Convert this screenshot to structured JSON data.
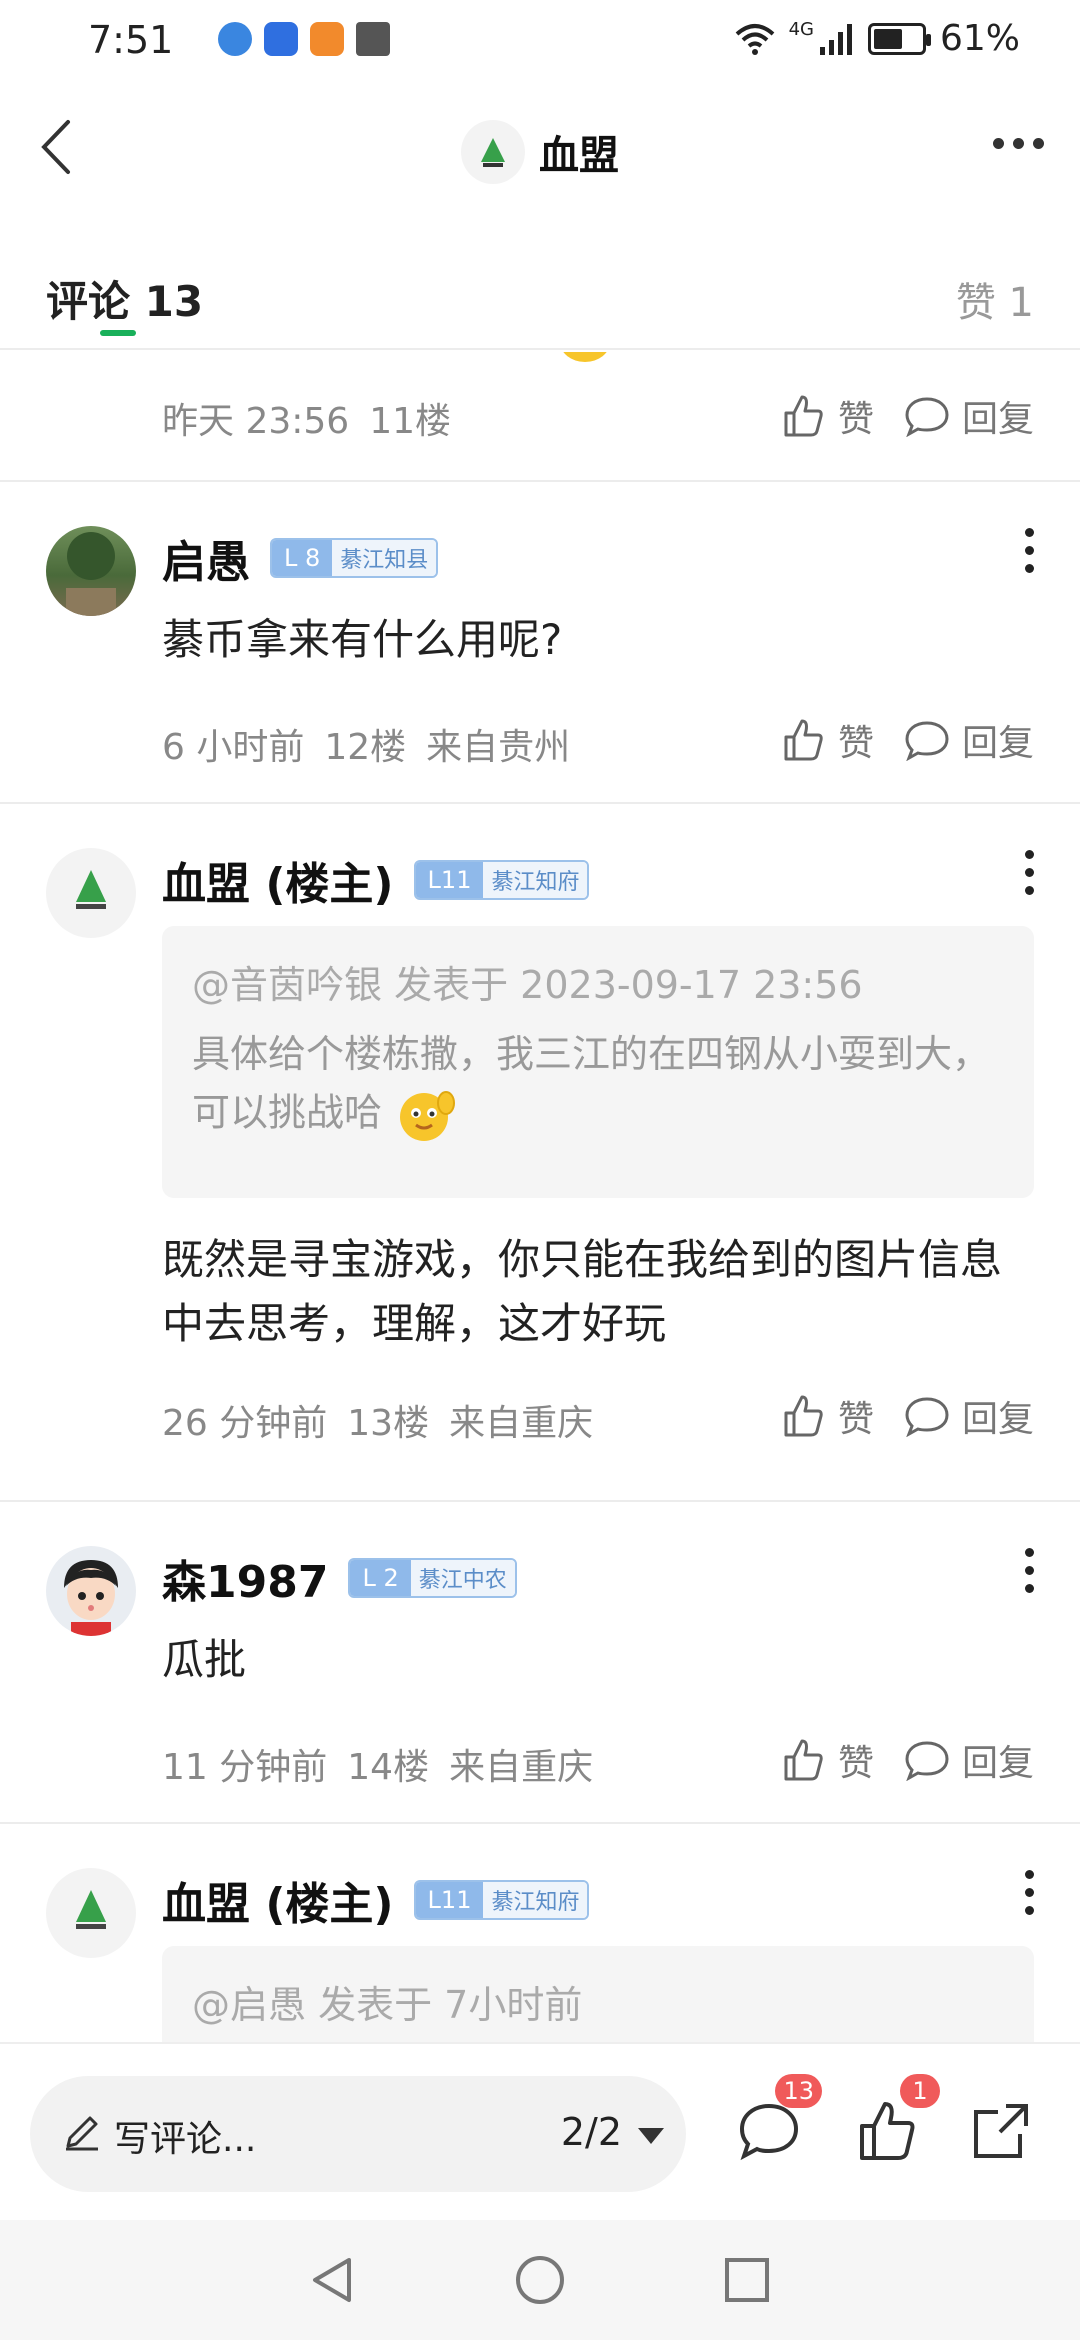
{
  "status_bar": {
    "time": "7:51",
    "battery": "61%",
    "network": "4G",
    "battery_level": 0.61
  },
  "header": {
    "title": "血盟"
  },
  "tabs": {
    "comments_label": "评论",
    "comments_count": "13",
    "likes_label": "赞 1"
  },
  "comments": [
    {
      "meta": {
        "time": "昨天 23:56",
        "floor": "11楼"
      }
    },
    {
      "name": "启愚",
      "level": "L 8",
      "title": "綦江知县",
      "text": "綦币拿来有什么用呢?",
      "meta": {
        "time": "6 小时前",
        "floor": "12楼",
        "location": "来自贵州"
      }
    },
    {
      "name": "血盟 (楼主)",
      "level": "L11",
      "title": "綦江知府",
      "quote": {
        "head": "@音茵吟银 发表于 2023-09-17 23:56",
        "body": "具体给个楼栋撒，我三江的在四钢从小耍到大，可以挑战哈"
      },
      "text": "既然是寻宝游戏，你只能在我给到的图片信息中去思考，理解，这才好玩",
      "meta": {
        "time": "26 分钟前",
        "floor": "13楼",
        "location": "来自重庆"
      }
    },
    {
      "name": "森1987",
      "level": "L 2",
      "title": "綦江中农",
      "text": "瓜批",
      "meta": {
        "time": "11 分钟前",
        "floor": "14楼",
        "location": "来自重庆"
      }
    },
    {
      "name": "血盟 (楼主)",
      "level": "L11",
      "title": "綦江知府",
      "quote": {
        "head": "@启愚 发表于 7小时前"
      }
    }
  ],
  "actions": {
    "like_label": "赞",
    "reply_label": "回复"
  },
  "bottom_bar": {
    "write_placeholder": "写评论...",
    "page_indicator": "2/2",
    "comment_count": "13",
    "like_count": "1"
  }
}
